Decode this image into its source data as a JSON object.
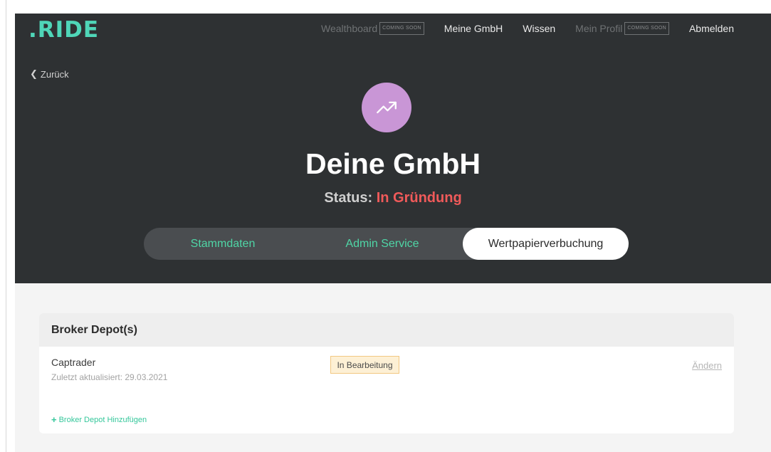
{
  "brand": {
    "logo": ".RIDE",
    "accent": "#4fd6b8"
  },
  "nav": {
    "items": [
      {
        "label": "Wealthboard",
        "badge": "COMING SOON",
        "disabled": true
      },
      {
        "label": "Meine GmbH"
      },
      {
        "label": "Wissen"
      },
      {
        "label": "Mein Profil",
        "badge": "COMING SOON",
        "disabled": true
      },
      {
        "label": "Abmelden"
      }
    ]
  },
  "back": {
    "label": "Zurück"
  },
  "company": {
    "avatar_icon": "trending-up-icon",
    "avatar_color": "#c996d6",
    "title": "Deine GmbH",
    "status_label": "Status:",
    "status_value": "In Gründung",
    "status_color": "#f05a5a"
  },
  "tabs": [
    {
      "label": "Stammdaten",
      "active": false
    },
    {
      "label": "Admin Service",
      "active": false
    },
    {
      "label": "Wertpapierverbuchung",
      "active": true
    }
  ],
  "broker_section": {
    "title": "Broker Depot(s)",
    "rows": [
      {
        "name": "Captrader",
        "updated": "Zuletzt aktualisiert: 29.03.2021",
        "status": "In Bearbeitung",
        "edit_label": "Ändern"
      }
    ],
    "add_label": "Broker Depot Hinzufügen"
  }
}
